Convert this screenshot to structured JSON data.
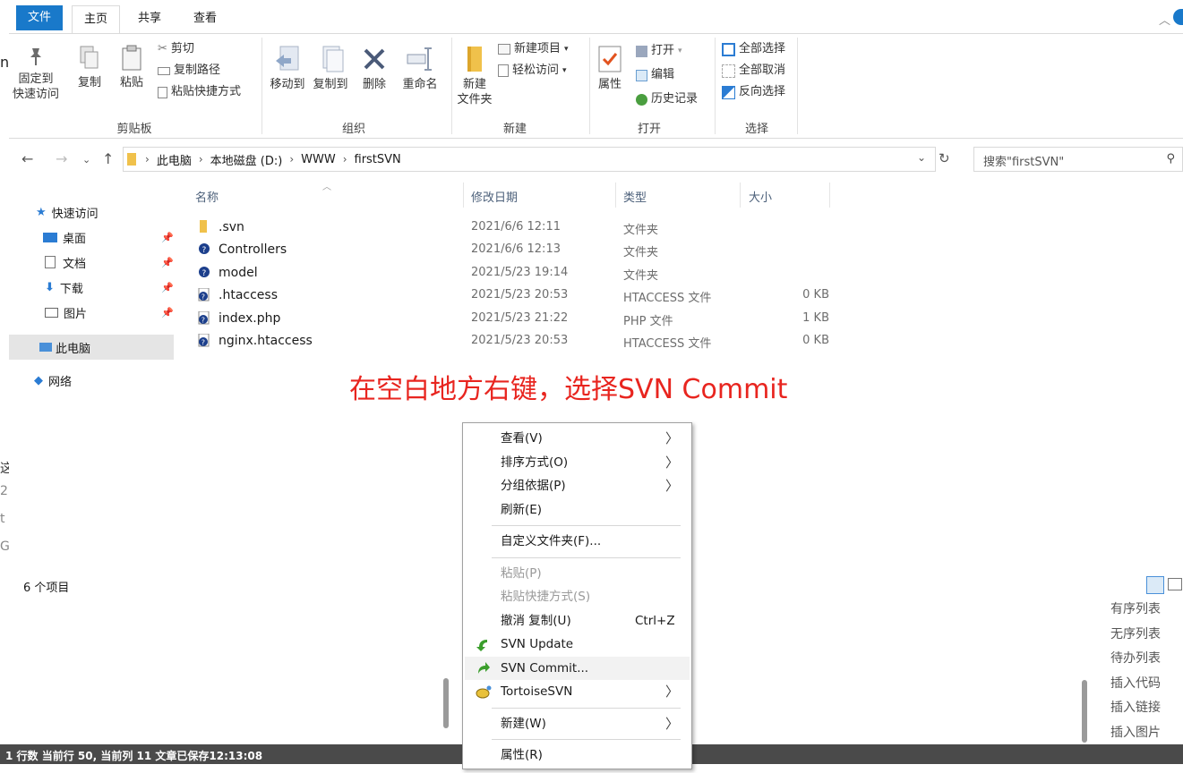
{
  "ribbon_tabs": {
    "file": "文件",
    "home": "主页",
    "share": "共享",
    "view": "查看"
  },
  "clipboard": {
    "pin_line1": "固定到",
    "pin_line2": "快速访问",
    "copy": "复制",
    "paste": "粘贴",
    "cut": "剪切",
    "copy_path": "复制路径",
    "paste_shortcut": "粘贴快捷方式",
    "group_label": "剪贴板"
  },
  "organize": {
    "move_to": "移动到",
    "copy_to": "复制到",
    "delete": "删除",
    "rename": "重命名",
    "group_label": "组织"
  },
  "new": {
    "new_folder_line1": "新建",
    "new_folder_line2": "文件夹",
    "new_item": "新建项目",
    "easy_access": "轻松访问",
    "group_label": "新建"
  },
  "open": {
    "properties": "属性",
    "open": "打开",
    "edit": "编辑",
    "history": "历史记录",
    "group_label": "打开"
  },
  "select": {
    "select_all": "全部选择",
    "select_none": "全部取消",
    "invert": "反向选择",
    "group_label": "选择"
  },
  "address": {
    "crumbs": [
      "此电脑",
      "本地磁盘 (D:)",
      "WWW",
      "firstSVN"
    ],
    "search_placeholder": "搜索\"firstSVN\""
  },
  "nav_pane": {
    "quick_access": "快速访问",
    "desktop": "桌面",
    "documents": "文档",
    "downloads": "下载",
    "pictures": "图片",
    "this_pc": "此电脑",
    "network": "网络"
  },
  "columns": {
    "name": "名称",
    "date": "修改日期",
    "type": "类型",
    "size": "大小"
  },
  "files": [
    {
      "name": ".svn",
      "date": "2021/6/6 12:11",
      "type": "文件夹",
      "size": ""
    },
    {
      "name": "Controllers",
      "date": "2021/6/6 12:13",
      "type": "文件夹",
      "size": ""
    },
    {
      "name": "model",
      "date": "2021/5/23 19:14",
      "type": "文件夹",
      "size": ""
    },
    {
      "name": ".htaccess",
      "date": "2021/5/23 20:53",
      "type": "HTACCESS 文件",
      "size": "0 KB"
    },
    {
      "name": "index.php",
      "date": "2021/5/23 21:22",
      "type": "PHP 文件",
      "size": "1 KB"
    },
    {
      "name": "nginx.htaccess",
      "date": "2021/5/23 20:53",
      "type": "HTACCESS 文件",
      "size": "0 KB"
    }
  ],
  "item_count": "6 个项目",
  "annotation": "在空白地方右键，选择SVN Commit",
  "context_menu": {
    "view": "查看(V)",
    "sort": "排序方式(O)",
    "group_by": "分组依据(P)",
    "refresh": "刷新(E)",
    "customize": "自定义文件夹(F)...",
    "paste": "粘贴(P)",
    "paste_shortcut": "粘贴快捷方式(S)",
    "undo_copy": "撤消 复制(U)",
    "undo_shortcut": "Ctrl+Z",
    "svn_update": "SVN Update",
    "svn_commit": "SVN Commit...",
    "tortoise": "TortoiseSVN",
    "new": "新建(W)",
    "properties": "属性(R)"
  },
  "editor": {
    "status": "1 行数  当前行 50, 当前列 11  文章已保存12:13:08",
    "md_items": [
      "有序列表",
      "无序列表",
      "待办列表",
      "插入代码",
      "插入链接",
      "插入图片"
    ]
  },
  "colors": {
    "file_tab": "#1979ca",
    "annotation": "#e8251f",
    "folder": "#f0c14b"
  }
}
